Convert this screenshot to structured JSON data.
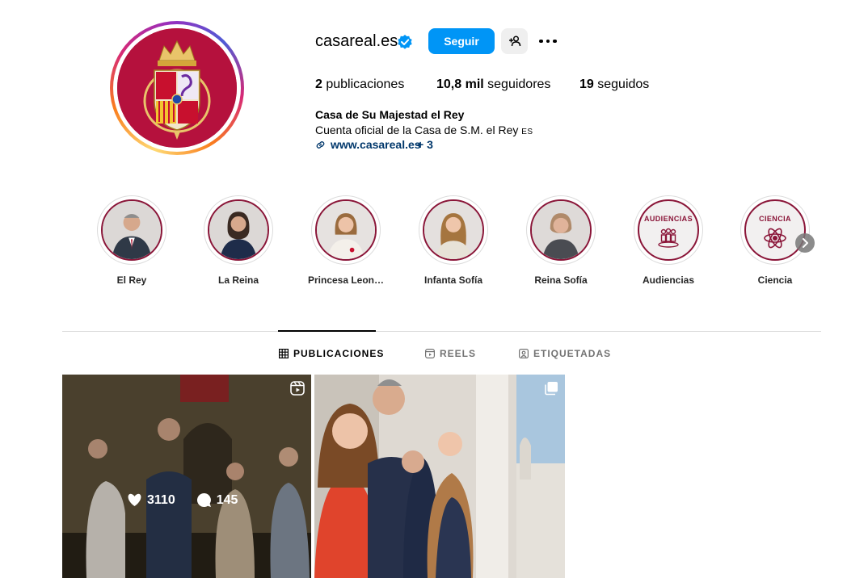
{
  "profile": {
    "username": "casareal.es",
    "follow_label": "Seguir",
    "stats": {
      "posts_count": "2",
      "posts_label": "publicaciones",
      "followers_count": "10,8 mil",
      "followers_label": "seguidores",
      "following_count": "19",
      "following_label": "seguidos"
    },
    "full_name": "Casa de Su Majestad el Rey",
    "bio": "Cuenta oficial de la Casa de S.M. el Rey",
    "bio_flag": "ES",
    "link": "www.casareal.es",
    "link_more": "+ 3"
  },
  "highlights": [
    {
      "label": "El Rey",
      "icon": "portrait-king"
    },
    {
      "label": "La Reina",
      "icon": "portrait-queen"
    },
    {
      "label": "Princesa Leon…",
      "icon": "portrait-princess"
    },
    {
      "label": "Infanta Sofía",
      "icon": "portrait-infanta"
    },
    {
      "label": "Reina Sofía",
      "icon": "portrait-queen-sofia"
    },
    {
      "label": "Audiencias",
      "icon": "audiences-icon",
      "cover_text": "AUDIENCIAS"
    },
    {
      "label": "Ciencia",
      "icon": "atom-icon",
      "cover_text": "CIENCIA"
    }
  ],
  "tabs": [
    {
      "label": "PUBLICACIONES",
      "icon": "grid-icon",
      "active": true
    },
    {
      "label": "REELS",
      "icon": "reels-icon",
      "active": false
    },
    {
      "label": "ETIQUETADAS",
      "icon": "tagged-icon",
      "active": false
    }
  ],
  "posts": [
    {
      "likes": "3110",
      "comments": "145",
      "type": "reel"
    },
    {
      "type": "carousel"
    }
  ],
  "colors": {
    "accent": "#0095f6",
    "brand": "#8a1538",
    "link": "#00376b"
  }
}
